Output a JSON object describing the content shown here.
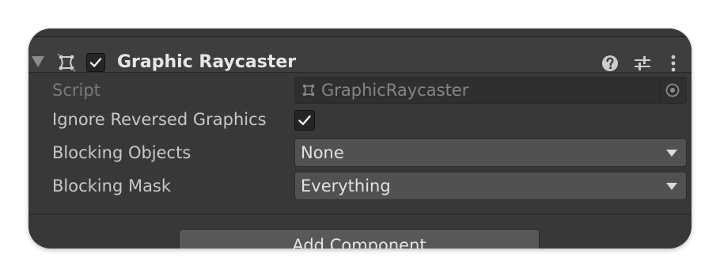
{
  "component": {
    "title": "Graphic Raycaster",
    "enabled": true,
    "icons": {
      "component": "rect-transform-icon",
      "help": "help-icon",
      "presets": "preset-sliders-icon",
      "menu": "kebab-menu-icon"
    }
  },
  "fields": {
    "script": {
      "label": "Script",
      "value": "GraphicRaycaster"
    },
    "ignore_reversed": {
      "label": "Ignore Reversed Graphics",
      "checked": true
    },
    "blocking_objects": {
      "label": "Blocking Objects",
      "value": "None"
    },
    "blocking_mask": {
      "label": "Blocking Mask",
      "value": "Everything"
    }
  },
  "add_component_label": "Add Component",
  "colors": {
    "panel_bg": "#383838",
    "header_bg": "#3e3e3e",
    "dropdown_bg": "#515151",
    "text": "#c8c8c8",
    "disabled_text": "#7a7a7a"
  }
}
